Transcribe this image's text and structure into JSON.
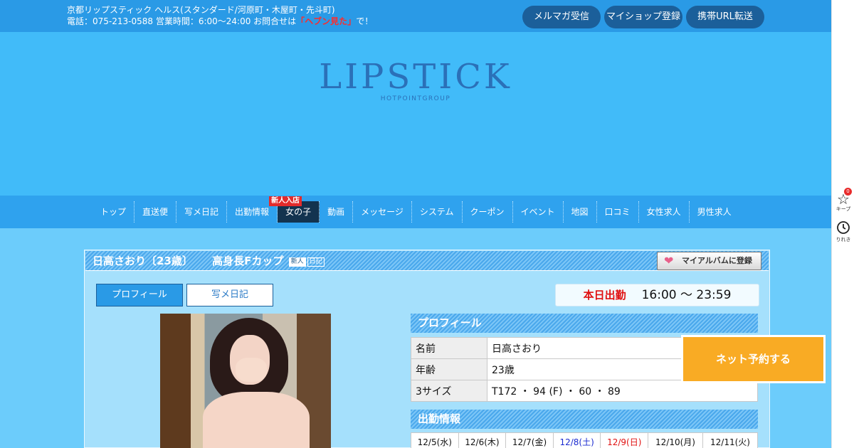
{
  "header": {
    "info_line1": "京都リップスティック ヘルス(スタンダード/河原町・木屋町・先斗町)",
    "info_line2_prefix": "電話：075-213-0588 営業時間：6:00～24:00 お問合せは",
    "info_line2_highlight": "「ヘブン見た」",
    "info_line2_suffix": "で！",
    "buttons": [
      "メルマガ受信",
      "マイショップ登録",
      "携帯URL転送"
    ]
  },
  "logo": {
    "title": "LIPSTICK",
    "subtitle": "HOTPOINTGROUP"
  },
  "nav": {
    "items": [
      "トップ",
      "直送便",
      "写メ日記",
      "出勤情報",
      "女の子",
      "動画",
      "メッセージ",
      "システム",
      "クーポン",
      "イベント",
      "地図",
      "口コミ",
      "女性求人",
      "男性求人"
    ],
    "active_index": 4,
    "badge": "新人入店"
  },
  "profile_title": {
    "name": "日高さおり〔23歳〕",
    "catch": "高身長Fカップ",
    "tag_new": "新人",
    "tag_diary": "日記"
  },
  "album_button": "マイアルバムに登録",
  "tabs": [
    "プロフィール",
    "写メ日記"
  ],
  "today_shift": {
    "label": "本日出勤",
    "time": "16:00 ～ 23:59"
  },
  "profile_section": {
    "title": "プロフィール",
    "rows": [
      {
        "key": "名前",
        "value": "日高さおり"
      },
      {
        "key": "年齢",
        "value": "23歳"
      },
      {
        "key": "3サイズ",
        "value": "T172 ・ 94 (F) ・ 60 ・ 89"
      }
    ]
  },
  "schedule_section": {
    "title": "出勤情報",
    "dates": [
      "12/5(水)",
      "12/6(木)",
      "12/7(金)",
      "12/8(土)",
      "12/9(日)",
      "12/10(月)",
      "12/11(火)"
    ]
  },
  "reserve_button": "ネット予約する",
  "sidebar": {
    "keep_label": "キープ",
    "keep_count": "0",
    "history_label": "りれき"
  },
  "colors": {
    "header_bg": "#2a9ae6",
    "hero_bg": "#41bbf9",
    "reserve": "#f9ab24",
    "nav_active": "#13334f"
  }
}
